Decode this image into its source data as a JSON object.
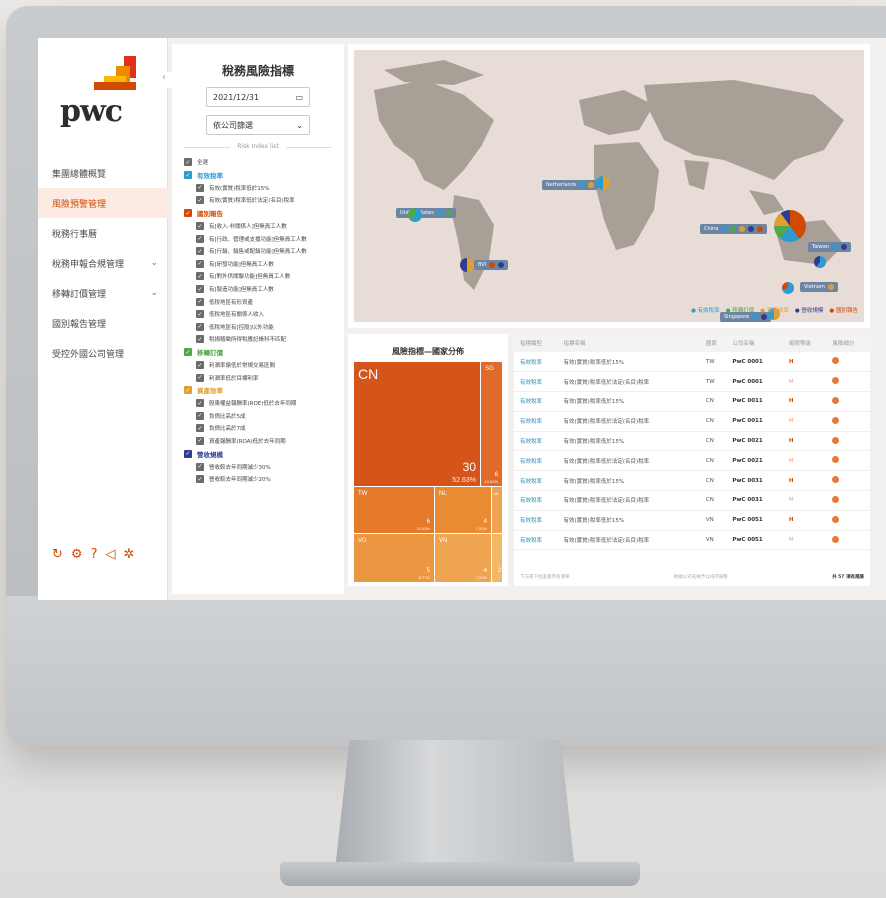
{
  "brand": {
    "logo_text": "pwc",
    "accent": "#d04a02"
  },
  "sidebar": {
    "items": [
      {
        "label": "集團總體概覽",
        "chevron": false,
        "active": false
      },
      {
        "label": "風險預警管理",
        "chevron": false,
        "active": true
      },
      {
        "label": "稅務行事曆",
        "chevron": false,
        "active": false
      },
      {
        "label": "稅務申報合規管理",
        "chevron": true,
        "active": false
      },
      {
        "label": "移轉訂價管理",
        "chevron": true,
        "active": false
      },
      {
        "label": "國別報告管理",
        "chevron": false,
        "active": false
      },
      {
        "label": "受控外國公司管理",
        "chevron": false,
        "active": false
      }
    ],
    "footer_icons": [
      "logout-icon",
      "settings-icon",
      "help-icon",
      "announce-icon",
      "bug-icon"
    ]
  },
  "risk_panel": {
    "title": "稅務風險指標",
    "date_value": "2021/12/31",
    "company_select": "依公司篩選",
    "list_caption": "Risk Index list",
    "select_all": "全選",
    "groups": [
      {
        "label": "有效稅率",
        "color": "#2e9bd1",
        "items": [
          "有效(實質)稅率低於15%",
          "有效(實質)稅率低於法定(名目)稅率"
        ]
      },
      {
        "label": "國別報告",
        "color": "#d04a02",
        "items": [
          "有[收入-非關係人]但無員工人數",
          "有[行政、管理或支援功能]但無員工人數",
          "有[行銷、銷售或配銷功能]但無員工人數",
          "有[研發功能]但無員工人數",
          "有[對外供關聯功能]但無員工人數",
          "有[製造功能]但無員工人數",
          "低稅地區有形資產",
          "低稅地區有關係人收入",
          "低稅地區有[控股]以外功能",
          "稅捐稽徵所得稅應記帳科不匹配"
        ]
      },
      {
        "label": "移轉訂價",
        "color": "#4fa84a",
        "items": [
          "利潤率偏低於常規交易區間",
          "利潤率低於目標利率"
        ]
      },
      {
        "label": "資產效率",
        "color": "#e0a030",
        "items": [
          "股東權益報酬率(ROE)低於去年同期",
          "負債比高於5成",
          "負債比高於7成",
          "資產報酬率(ROA)低於去年同期"
        ]
      },
      {
        "label": "營收規模",
        "color": "#2f3c8f",
        "items": [
          "營收較去年同期減少30%",
          "營收較去年同期減少20%"
        ]
      }
    ]
  },
  "map": {
    "labels": [
      "Netherlands",
      "United States",
      "China",
      "Taiwan",
      "BVI",
      "Vietnam",
      "Singapore"
    ],
    "legend": [
      {
        "label": "有效稅率",
        "color": "#2e9bd1"
      },
      {
        "label": "移轉訂價",
        "color": "#4fa84a"
      },
      {
        "label": "資產效率",
        "color": "#e0a030"
      },
      {
        "label": "營收規模",
        "color": "#2f3c8f"
      },
      {
        "label": "國別報告",
        "color": "#d04a02"
      }
    ]
  },
  "treemap": {
    "title": "風險指標—國家分佈",
    "cells": [
      {
        "code": "CN",
        "value": "30",
        "pct": "52.63%"
      },
      {
        "code": "SG",
        "value": "6",
        "pct": "10.53%"
      },
      {
        "code": "TW",
        "value": "6",
        "pct": "10.53%"
      },
      {
        "code": "NL",
        "value": "4",
        "pct": "7.02%"
      },
      {
        "code": "UK",
        "value": "",
        "pct": ""
      },
      {
        "code": "VG",
        "value": "5",
        "pct": "8.77%"
      },
      {
        "code": "VN",
        "value": "4",
        "pct": "7.02%"
      },
      {
        "code": "",
        "value": "2",
        "pct": ""
      }
    ]
  },
  "table": {
    "headers": [
      "指標類型",
      "指標名稱",
      "國家",
      "公司名稱",
      "風險等級",
      "風險細分"
    ],
    "rows": [
      [
        "有效稅率",
        "有效(實質)稅率低於15%",
        "TW",
        "PwC 0001",
        "H"
      ],
      [
        "有效稅率",
        "有效(實質)稅率低於法定(名目)稅率",
        "TW",
        "PwC 0001",
        "M"
      ],
      [
        "有效稅率",
        "有效(實質)稅率低於15%",
        "CN",
        "PwC 0011",
        "H"
      ],
      [
        "有效稅率",
        "有效(實質)稅率低於法定(名目)稅率",
        "CN",
        "PwC 0011",
        "M"
      ],
      [
        "有效稅率",
        "有效(實質)稅率低於15%",
        "CN",
        "PwC 0021",
        "H"
      ],
      [
        "有效稅率",
        "有效(實質)稅率低於法定(名目)稅率",
        "CN",
        "PwC 0021",
        "M"
      ],
      [
        "有效稅率",
        "有效(實質)稅率低於15%",
        "CN",
        "PwC 0031",
        "H"
      ],
      [
        "有效稅率",
        "有效(實質)稅率低於法定(名目)稅率",
        "CN",
        "PwC 0031",
        "M"
      ],
      [
        "有效稅率",
        "有效(實質)稅率低於15%",
        "VN",
        "PwC 0051",
        "H"
      ],
      [
        "有效稅率",
        "有效(實質)稅率低於法定(名目)稅率",
        "VN",
        "PwC 0051",
        "M"
      ]
    ],
    "footer_left": "下方或下拉查看所有清單",
    "footer_mid": "依據公司名稱予以排序調整",
    "footer_right": "共 57 項有風險"
  }
}
